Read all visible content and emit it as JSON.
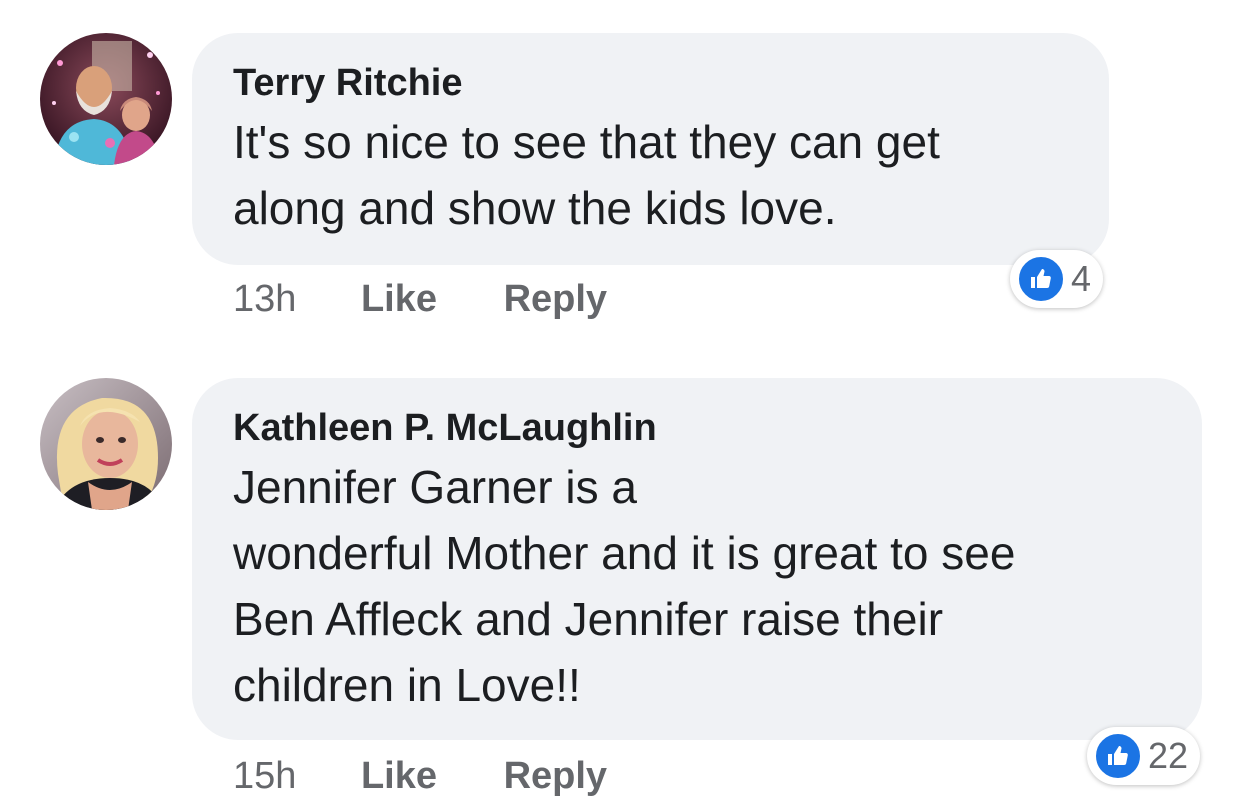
{
  "comments": [
    {
      "author": "Terry Ritchie",
      "text_lines": [
        "It's so nice to see that they can get",
        "along and show the kids love."
      ],
      "time": "13h",
      "like_label": "Like",
      "reply_label": "Reply",
      "reaction_icon": "thumbs-up-icon",
      "reaction_count": "4"
    },
    {
      "author": "Kathleen P. McLaughlin",
      "text_lines": [
        "Jennifer Garner is a",
        "wonderful Mother and it is great to see",
        "Ben Affleck and Jennifer raise their",
        "children in Love!!"
      ],
      "time": "15h",
      "like_label": "Like",
      "reply_label": "Reply",
      "reaction_icon": "thumbs-up-icon",
      "reaction_count": "22"
    }
  ],
  "colors": {
    "bubble_bg": "#f0f2f5",
    "meta_text": "#65676b",
    "like_blue": "#1b74e4"
  }
}
